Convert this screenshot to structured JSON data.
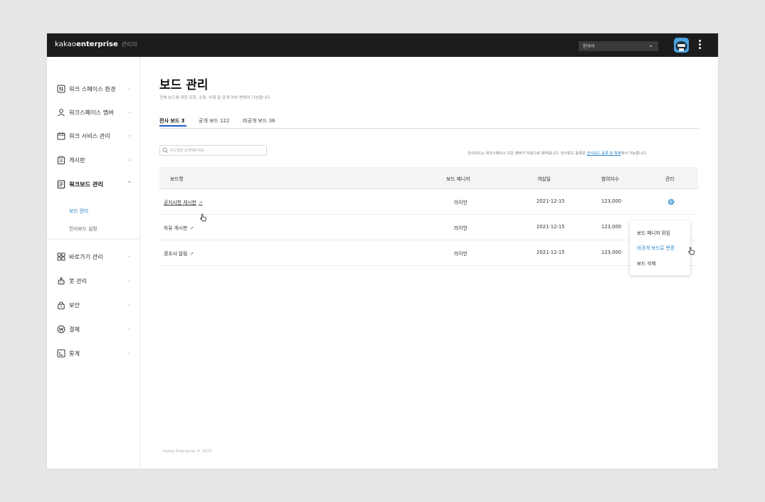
{
  "header": {
    "brand_prefix": "kakao",
    "brand_bold": "enterprise",
    "brand_suffix": "관리자",
    "language": "한국어"
  },
  "sidebar": {
    "items": [
      {
        "label": "워크 스페이스 환경",
        "icon": "settings-sliders-icon"
      },
      {
        "label": "워크스페이스 멤버",
        "icon": "person-icon"
      },
      {
        "label": "워크 서비스 관리",
        "icon": "calendar-box-icon"
      },
      {
        "label": "게시판",
        "icon": "clipboard-icon"
      },
      {
        "label": "워크보드 관리",
        "icon": "document-icon"
      },
      {
        "label": "바로가기 관리",
        "icon": "grid-icon"
      },
      {
        "label": "봇 관리",
        "icon": "bot-icon"
      },
      {
        "label": "보안",
        "icon": "lock-icon"
      },
      {
        "label": "결제",
        "icon": "won-coin-icon"
      },
      {
        "label": "통계",
        "icon": "chart-icon"
      }
    ],
    "sub_items": [
      "보드 관리",
      "전사보드 설정"
    ]
  },
  "main": {
    "title": "보드 관리",
    "description": "전체 보드에 대한 조회, 수정, 삭제 및 공개 여부 변경이 가능합니다.",
    "tabs": [
      "전사 보드 3",
      "공개 보드 122",
      "비공개 보드 36"
    ],
    "search_placeholder": "보드명을 검색해보세요.",
    "notice_prefix": "전사보드는 워크스페이스 모든 멤버가 자동으로 참여됩니다. 전사보드 등록은 ",
    "notice_link": "전사보드 등록 및 해제",
    "notice_suffix": "에서 가능합니다.",
    "table": {
      "headers": [
        "보드명",
        "보드 매니저",
        "개설일",
        "참여자수",
        "관리"
      ],
      "rows": [
        {
          "name": "공지사항 게시판",
          "manager": "라이언",
          "date": "2021-12-15",
          "count": "123,000"
        },
        {
          "name": "자유 게시판",
          "manager": "라이언",
          "date": "2021-12-15",
          "count": "123,000"
        },
        {
          "name": "경조사 알림",
          "manager": "라이언",
          "date": "2021-12-15",
          "count": "123,000"
        }
      ]
    },
    "external_link_glyph": "↗",
    "dropdown": [
      "보드 매니저 위임",
      "비공개 보드로 변경",
      "보드 삭제"
    ],
    "footer": "Kakao Enterprise © 2020"
  },
  "colors": {
    "accent": "#2b86c8",
    "topbar": "#1c1c1e",
    "tab_underline": "#1e5dc8"
  }
}
